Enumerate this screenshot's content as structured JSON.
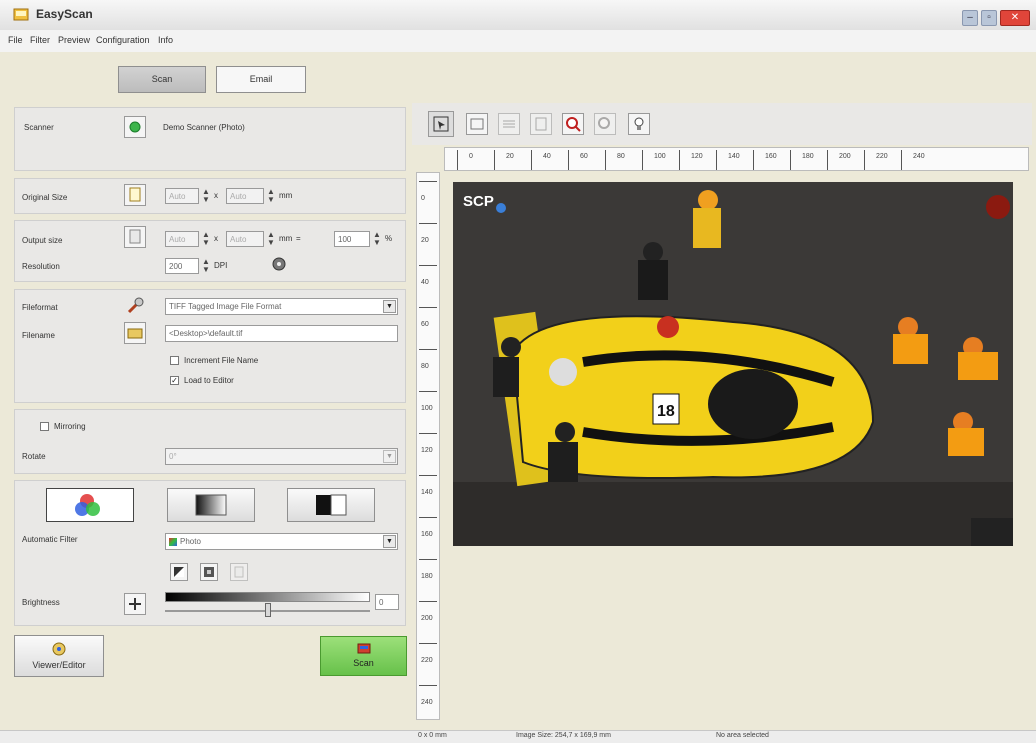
{
  "window": {
    "title": "EasyScan",
    "controls": [
      "–",
      "▫",
      "✕"
    ]
  },
  "menu": {
    "items": [
      "File",
      "Filter",
      "Preview",
      "Configuration",
      "Info"
    ]
  },
  "tabs": {
    "scan": "Scan",
    "email": "Email"
  },
  "scanner": {
    "label": "Scanner",
    "value": "Demo Scanner (Photo)"
  },
  "original_size": {
    "label": "Original Size",
    "width": "Auto",
    "height": "Auto",
    "times": "x",
    "unit": "mm"
  },
  "output_size": {
    "label": "Output size",
    "width": "Auto",
    "height": "Auto",
    "times": "x",
    "unit": "mm",
    "equals": "=",
    "percent": "100",
    "percent_sign": "%"
  },
  "resolution": {
    "label": "Resolution",
    "value": "200",
    "unit": "DPI"
  },
  "file": {
    "format_label": "Fileformat",
    "format_value": "TIFF Tagged Image File Format",
    "name_label": "Filename",
    "name_value": "<Desktop>\\default.tif",
    "increment_label": "Increment File Name",
    "increment_checked": false,
    "load_label": "Load to Editor",
    "load_checked": true
  },
  "mirroring": {
    "label": "Mirroring",
    "checked": false
  },
  "rotate": {
    "label": "Rotate",
    "value": "0°"
  },
  "filters": {
    "label": "Automatic Filter",
    "value": "Photo"
  },
  "brightness": {
    "label": "Brightness",
    "value": "0",
    "level": 0.5
  },
  "bottom": {
    "viewer_label": "Viewer/Editor",
    "scan_label": "Scan"
  },
  "preview": {
    "watermark": "SCP",
    "car_number": "18",
    "ruler_top": [
      "0",
      "20",
      "40",
      "60",
      "80",
      "100",
      "120",
      "140",
      "160",
      "180",
      "200",
      "220",
      "240"
    ],
    "ruler_left": [
      "0",
      "20",
      "40",
      "60",
      "80",
      "100",
      "120",
      "140",
      "160",
      "180",
      "200",
      "220",
      "240"
    ]
  },
  "status": {
    "left": "0 x 0 mm",
    "middle": "Image Size: 254,7 x 169,9 mm",
    "right": "No area selected"
  },
  "colors": {
    "scan_button": "#7fd15f",
    "car": "#f2d01a"
  }
}
